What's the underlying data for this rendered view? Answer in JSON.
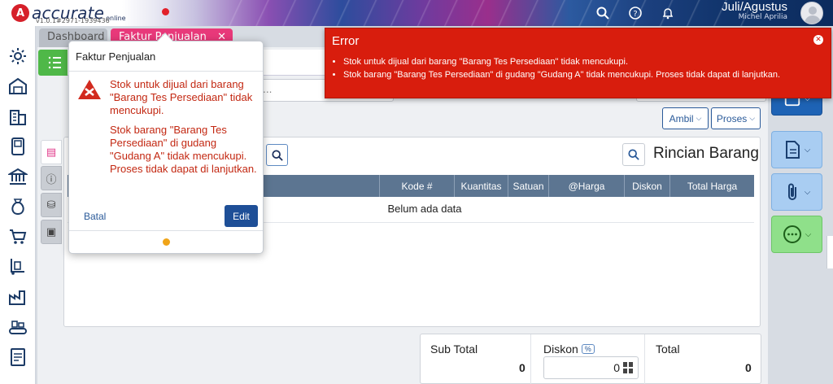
{
  "header": {
    "logo_letter": "A",
    "logo_text": "accurate",
    "logo_sub": "online",
    "version": "v1.0.1#2971-1939436",
    "period": "Juli/Agustus",
    "user": "Michel Aprilia"
  },
  "tabs": [
    {
      "label": "Dashboard"
    },
    {
      "label": "Faktur Penjualan",
      "close": "✕"
    }
  ],
  "toolbar": {
    "input_placeholder": "...",
    "ambil_label": "Ambil",
    "proses_label": "Proses"
  },
  "detail": {
    "title": "Rincian Barang",
    "columns": [
      "Kode #",
      "Kuantitas",
      "Satuan",
      "@Harga",
      "Diskon",
      "Total Harga"
    ],
    "empty_text": "Belum ada data"
  },
  "totals": {
    "subtotal_label": "Sub Total",
    "subtotal_value": "0",
    "diskon_label": "Diskon",
    "diskon_badge": "%",
    "diskon_value": "0",
    "total_label": "Total",
    "total_value": "0"
  },
  "error_toast": {
    "title": "Error",
    "close": "✕",
    "messages": [
      "Stok untuk dijual dari barang \"Barang Tes Persediaan\" tidak mencukupi.",
      "Stok barang \"Barang Tes Persediaan\" di gudang \"Gudang A\" tidak mencukupi. Proses tidak dapat di lanjutkan."
    ]
  },
  "popup": {
    "title": "Faktur Penjualan",
    "message1": "Stok untuk dijual dari barang \"Barang Tes Persediaan\" tidak mencukupi.",
    "message2": "Stok barang \"Barang Tes Persediaan\" di gudang \"Gudang A\" tidak mencukupi. Proses tidak dapat di lanjutkan.",
    "cancel_label": "Batal",
    "edit_label": "Edit"
  },
  "colors": {
    "accent_pink": "#e8397a",
    "error_red": "#d81d0d",
    "primary_blue": "#1e4f97",
    "green": "#4fb848"
  },
  "icons": [
    "search-icon",
    "help-icon",
    "bell-icon",
    "gear-icon",
    "warehouse-icon",
    "building-icon",
    "book-icon",
    "bank-icon",
    "money-bag-icon",
    "cart-icon",
    "trolley-icon",
    "factory-icon",
    "conveyor-icon",
    "tax-icon",
    "list-icon",
    "document-icon",
    "attachment-icon",
    "more-icon",
    "calculator-icon"
  ]
}
